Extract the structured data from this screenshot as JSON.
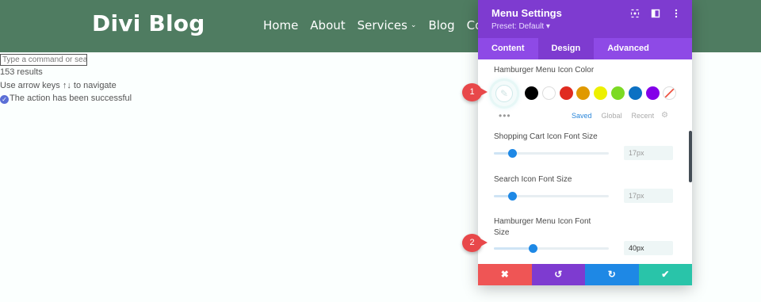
{
  "site": {
    "logo": "Divi Blog",
    "nav": [
      {
        "label": "Home",
        "dropdown": false
      },
      {
        "label": "About",
        "dropdown": false
      },
      {
        "label": "Services",
        "dropdown": true
      },
      {
        "label": "Blog",
        "dropdown": false
      },
      {
        "label": "Conta",
        "dropdown": false
      }
    ]
  },
  "command": {
    "placeholder": "Type a command or sear",
    "results": "153 results",
    "hint": "Use arrow keys ↑↓ to navigate",
    "success": "The action has been successful"
  },
  "panel": {
    "title": "Menu Settings",
    "preset": "Preset: Default ▾",
    "tabs": [
      "Content",
      "Design",
      "Advanced"
    ],
    "active_tab": "Design",
    "hamburger_color": {
      "label": "Hamburger Menu Icon Color",
      "swatches": [
        "#000000",
        "#ffffff",
        "#e02b20",
        "#e09900",
        "#edf000",
        "#7cda24",
        "#0c71c3",
        "#8300e9"
      ],
      "more": "•••",
      "color_tabs": [
        "Saved",
        "Global",
        "Recent"
      ],
      "active_color_tab": "Saved"
    },
    "sliders": [
      {
        "label": "Shopping Cart Icon Font Size",
        "value": "17px",
        "level": 0.16
      },
      {
        "label": "Search Icon Font Size",
        "value": "17px",
        "level": 0.16
      },
      {
        "label_line1": "Hamburger Menu Icon Font",
        "label_line2": "Size",
        "value": "40px",
        "level": 0.34
      }
    ],
    "footer": {
      "cancel": "✖",
      "undo": "↺",
      "redo": "↻",
      "save": "✔"
    }
  },
  "badges": [
    "1",
    "2"
  ],
  "colors": {
    "header_green": "#4f7c61",
    "panel_purple": "#7e3bd0",
    "tab_purple": "#8e4ae6",
    "accent_blue": "#1e88e5",
    "save_green": "#29c4a9",
    "cancel_red": "#ef5555",
    "badge_red": "#e8484a"
  }
}
